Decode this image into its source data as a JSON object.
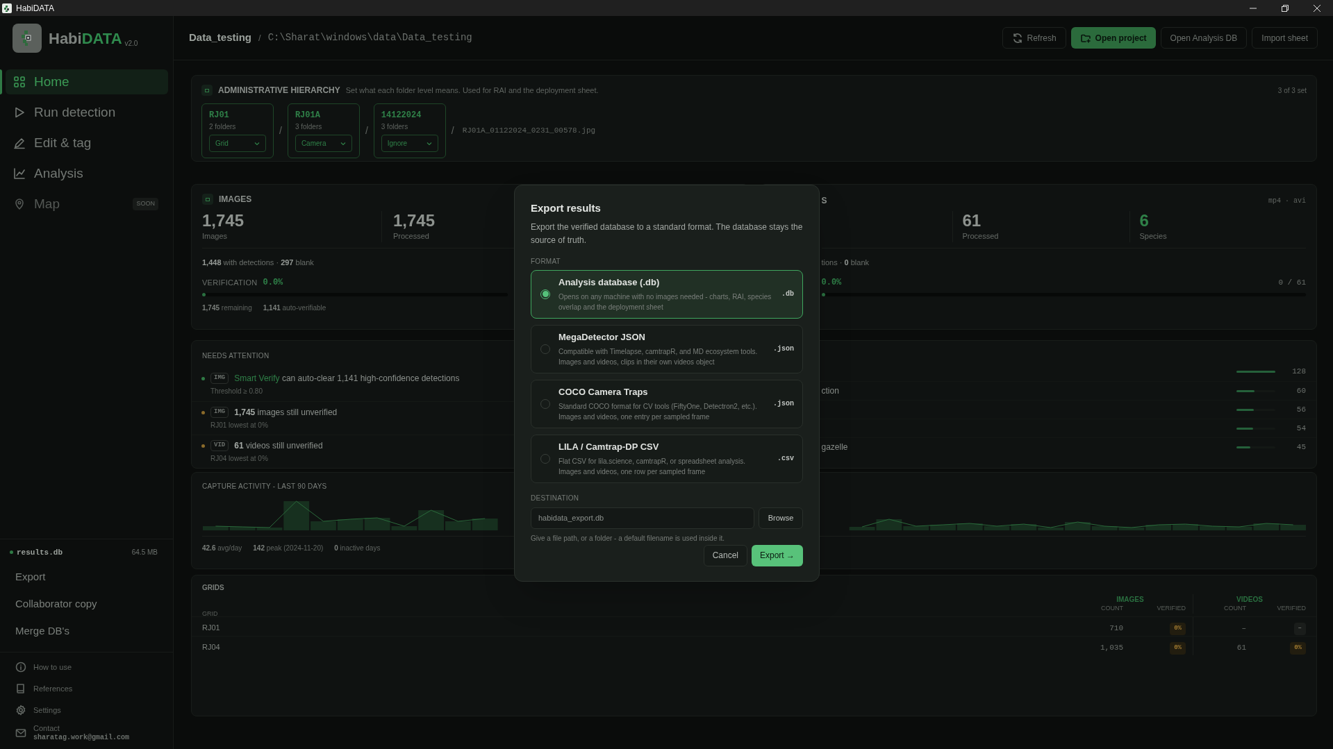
{
  "title_bar": {
    "title": "HabiDATA"
  },
  "sidebar": {
    "logo": {
      "prefix": "Habi",
      "accent": "DATA",
      "version": "v2.0"
    },
    "nav": [
      {
        "label": "Home",
        "selected": true,
        "disabled": false
      },
      {
        "label": "Run detection",
        "selected": false,
        "disabled": false
      },
      {
        "label": "Edit & tag",
        "selected": false,
        "disabled": false
      },
      {
        "label": "Analysis",
        "selected": false,
        "disabled": false
      },
      {
        "label": "Map",
        "selected": false,
        "disabled": true,
        "badge": "SOON"
      }
    ],
    "database": {
      "name": "results.db",
      "size": "64.5 MB"
    },
    "actions": [
      "Export",
      "Collaborator copy",
      "Merge DB's"
    ],
    "links": [
      {
        "label": "How to use"
      },
      {
        "label": "References"
      },
      {
        "label": "Settings"
      },
      {
        "label": "Contact",
        "detail": "sharatag.work@gmail.com"
      }
    ]
  },
  "header": {
    "breadcrumb": "Data_testing",
    "separator": "/",
    "path": "C:\\Sharat\\windows\\data\\Data_testing",
    "buttons": [
      {
        "label": "Refresh",
        "primary": false
      },
      {
        "label": "Open project",
        "primary": true
      },
      {
        "label": "Open Analysis DB",
        "primary": false
      },
      {
        "label": "Import sheet",
        "primary": false
      }
    ]
  },
  "hierarchy": {
    "title": "ADMINISTRATIVE HIERARCHY",
    "description": "Set what each folder level means. Used for RAI and the deployment sheet.",
    "status": "3 of 3 set",
    "levels": [
      {
        "name": "RJ01",
        "count": "2 folders",
        "role": "Grid"
      },
      {
        "name": "RJ01A",
        "count": "3 folders",
        "role": "Camera"
      },
      {
        "name": "14122024",
        "count": "3 folders",
        "role": "Ignore"
      }
    ],
    "separators": [
      "/",
      "/",
      "/"
    ],
    "filename": "RJ01A_01122024_0231_00578.jpg"
  },
  "images": {
    "title": "IMAGES",
    "stats": [
      {
        "value": "1,745",
        "label": "Images"
      },
      {
        "value": "1,745",
        "label": "Processed"
      }
    ],
    "detections": "**1,448** with detections · **297** blank",
    "verification": {
      "label": "VERIFICATION",
      "value": "0.0%",
      "level": 0
    },
    "footer": [
      "**1,745** remaining",
      "**1,141** auto-verifiable"
    ]
  },
  "videos": {
    "title": "S",
    "formats": "mp4 · avi",
    "stats": [
      {
        "value": "61",
        "label": "Processed",
        "accent": false
      },
      {
        "value": "6",
        "label": "Species",
        "accent": true
      }
    ],
    "detections": "tions · **0** blank",
    "verification": {
      "value": "0.0%",
      "reading": "0 / 61",
      "level": 0
    }
  },
  "attention": {
    "title": "NEEDS ATTENTION",
    "items": [
      {
        "color": "#2f7a45",
        "tag": "IMG",
        "link": "Smart Verify",
        "text": "can auto-clear 1,141 high-confidence detections",
        "note": "Threshold ≥ 0.80"
      },
      {
        "color": "#8a6a2a",
        "tag": "IMG",
        "text": "**1,745** images still unverified",
        "note": "RJ01 lowest at 0%"
      },
      {
        "color": "#8a6a2a",
        "tag": "VID",
        "text": "**61** videos still unverified",
        "note": "RJ04 lowest at 0%"
      }
    ]
  },
  "species": {
    "rows": [
      {
        "count": "128",
        "level": 1
      },
      {
        "label": "ction",
        "count": "60",
        "level": 0.47
      },
      {
        "count": "56",
        "level": 0.44
      },
      {
        "count": "54",
        "level": 0.42
      },
      {
        "label": "gazelle",
        "count": "45",
        "level": 0.35
      }
    ]
  },
  "activity": {
    "title": "CAPTURE ACTIVITY - LAST 90 DAYS",
    "stats": [
      "**42.6** avg/day",
      "**142** peak (2024-11-20)",
      "**0** inactive days"
    ]
  },
  "grids": {
    "title": "GRIDS",
    "first_header": "GRID",
    "group_headers": [
      "IMAGES",
      "VIDEOS"
    ],
    "sub_headers": [
      "COUNT",
      "VERIFIED",
      "COUNT",
      "VERIFIED"
    ],
    "rows": [
      {
        "grid": "RJ01",
        "image_count": "710",
        "image_verified": {
          "text": "0%",
          "pending": true
        },
        "video_count": "–",
        "video_verified": {
          "text": "–",
          "pending": false
        }
      },
      {
        "grid": "RJ04",
        "image_count": "1,035",
        "image_verified": {
          "text": "0%",
          "pending": true
        },
        "video_count": "61",
        "video_verified": {
          "text": "0%",
          "pending": true
        }
      }
    ]
  },
  "export_dialog": {
    "title": "Export results",
    "description": "Export the verified database to a standard format. The database stays the source of truth.",
    "format_label": "FORMAT",
    "options": [
      {
        "name": "Analysis database (.db)",
        "description": "Opens on any machine with no images needed - charts, RAI, species overlap and the deployment sheet",
        "extension": ".db",
        "selected": true
      },
      {
        "name": "MegaDetector JSON",
        "description": "Compatible with Timelapse, camtrapR, and MD ecosystem tools. Images and videos, clips in their own videos object",
        "extension": ".json",
        "selected": false
      },
      {
        "name": "COCO Camera Traps",
        "description": "Standard COCO format for CV tools (FiftyOne, Detectron2, etc.). Images and videos, one entry per sampled frame",
        "extension": ".json",
        "selected": false
      },
      {
        "name": "LILA / Camtrap-DP CSV",
        "description": "Flat CSV for lila.science, camtrapR, or spreadsheet analysis. Images and videos, one row per sampled frame",
        "extension": ".csv",
        "selected": false
      }
    ],
    "destination_label": "DESTINATION",
    "destination": {
      "value": "habidata_export.db"
    },
    "browse": "Browse",
    "hint": "Give a file path, or a folder - a default filename is used inside it.",
    "buttons": [
      {
        "label": "Cancel",
        "primary": false
      },
      {
        "label": "Export →",
        "primary": true
      }
    ]
  }
}
